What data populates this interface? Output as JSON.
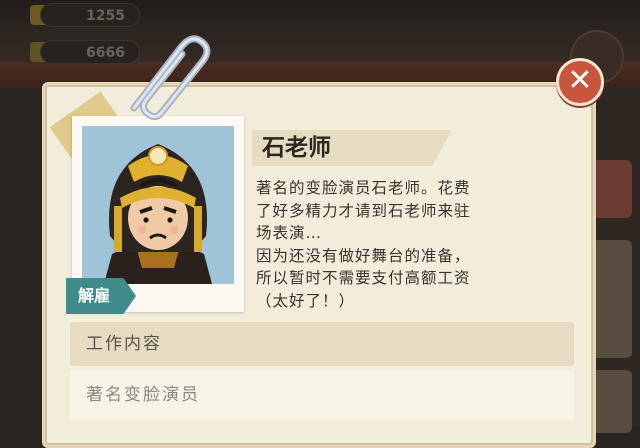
{
  "currency": {
    "gold": "1255",
    "cash": "6666"
  },
  "character": {
    "name": "石老师",
    "description_lines": [
      "著名的变脸演员石老师。花费",
      "了好多精力才请到石老师来驻",
      "场表演…",
      "因为还没有做好舞台的准备，",
      "所以暂时不需要支付高额工资",
      "（太好了！）"
    ],
    "fire_label": "解雇"
  },
  "work": {
    "header": "工作内容",
    "value": "著名变脸演员"
  },
  "icons": {
    "close": "close-icon",
    "paperclip": "paperclip-icon",
    "coin": "coin-icon",
    "cash": "cash-icon"
  },
  "colors": {
    "close_button": "#c9553f",
    "fire_button": "#3f8c8a",
    "card": "#f2ecda"
  }
}
